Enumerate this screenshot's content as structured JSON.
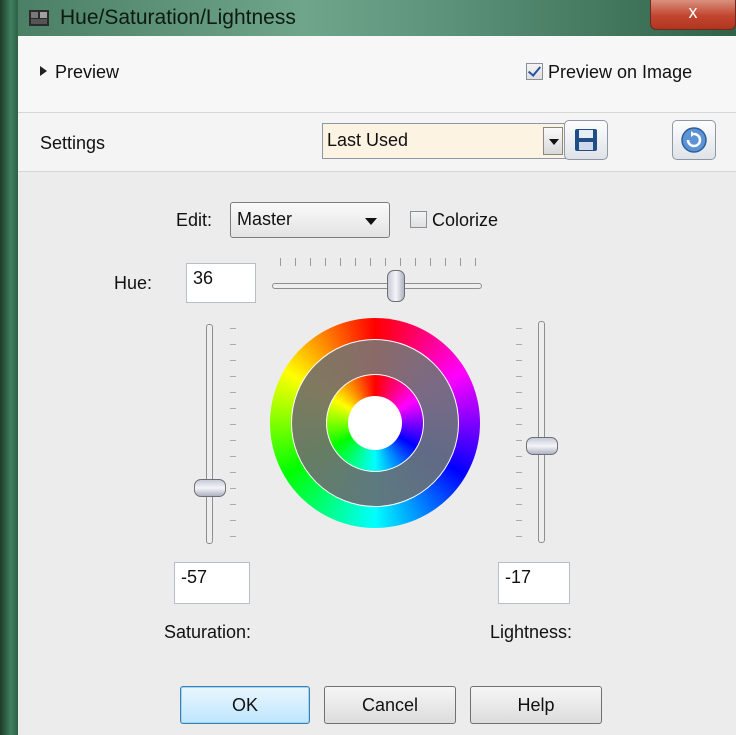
{
  "window": {
    "title": "Hue/Saturation/Lightness",
    "close_glyph": "x"
  },
  "preview": {
    "toggle_label": "Preview",
    "on_image_label": "Preview on Image",
    "on_image_checked": true
  },
  "settings": {
    "label": "Settings",
    "selected": "Last Used"
  },
  "edit": {
    "label": "Edit:",
    "selected": "Master",
    "colorize_label": "Colorize",
    "colorize_checked": false
  },
  "hue": {
    "label": "Hue:",
    "value": "36"
  },
  "saturation": {
    "label": "Saturation:",
    "value": "-57"
  },
  "lightness": {
    "label": "Lightness:",
    "value": "-17"
  },
  "buttons": {
    "ok": "OK",
    "cancel": "Cancel",
    "help": "Help"
  },
  "icons": {
    "title": "app-icon",
    "save": "save-disk-icon",
    "reset": "reset-arrow-icon"
  },
  "colors": {
    "accent": "#2a4fa8",
    "default_button": "#3c7fb1",
    "settings_bg": "#fdf3e3"
  }
}
